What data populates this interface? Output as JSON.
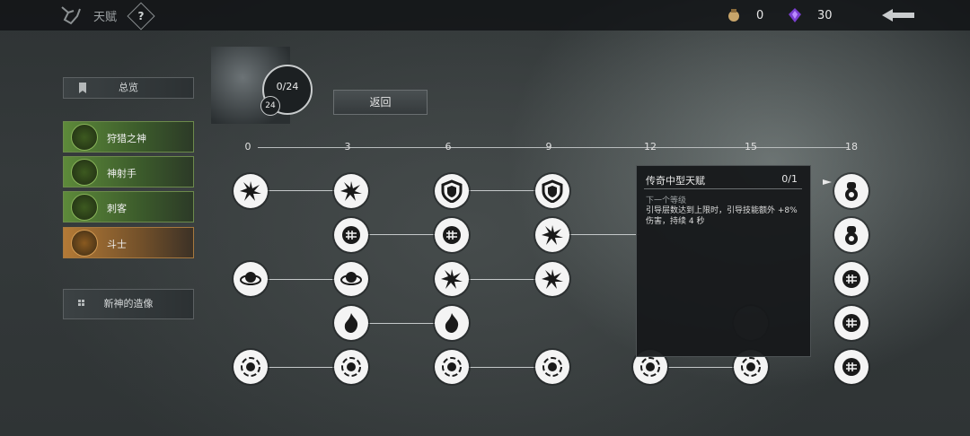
{
  "header": {
    "title": "天赋"
  },
  "help": {
    "label": "?"
  },
  "currencies": [
    {
      "icon": "bag-icon",
      "value": "0"
    },
    {
      "icon": "crystal-icon",
      "value": "30"
    }
  ],
  "sidebar": {
    "overview_label": "总览",
    "classes": [
      {
        "label": "狩猎之神",
        "icon": "hunter-god-icon",
        "color": "#5d8a3a"
      },
      {
        "label": "神射手",
        "icon": "marksman-icon",
        "color": "#5d8a3a"
      },
      {
        "label": "刺客",
        "icon": "assassin-icon",
        "color": "#5d8a3a"
      },
      {
        "label": "斗士",
        "icon": "fighter-icon",
        "color": "#b47a36"
      }
    ],
    "statue_label": "新神的造像"
  },
  "progress": {
    "text": "0/24",
    "badge": "24"
  },
  "return_label": "返回",
  "tiers": [
    "0",
    "3",
    "6",
    "9",
    "12",
    "15",
    "18"
  ],
  "tooltip": {
    "title": "传奇中型天赋",
    "count": "0/1",
    "subtitle": "下一个等级",
    "description": "引导层数达到上限时，引导技能额外 +8% 伤害，持续 4 秒"
  }
}
